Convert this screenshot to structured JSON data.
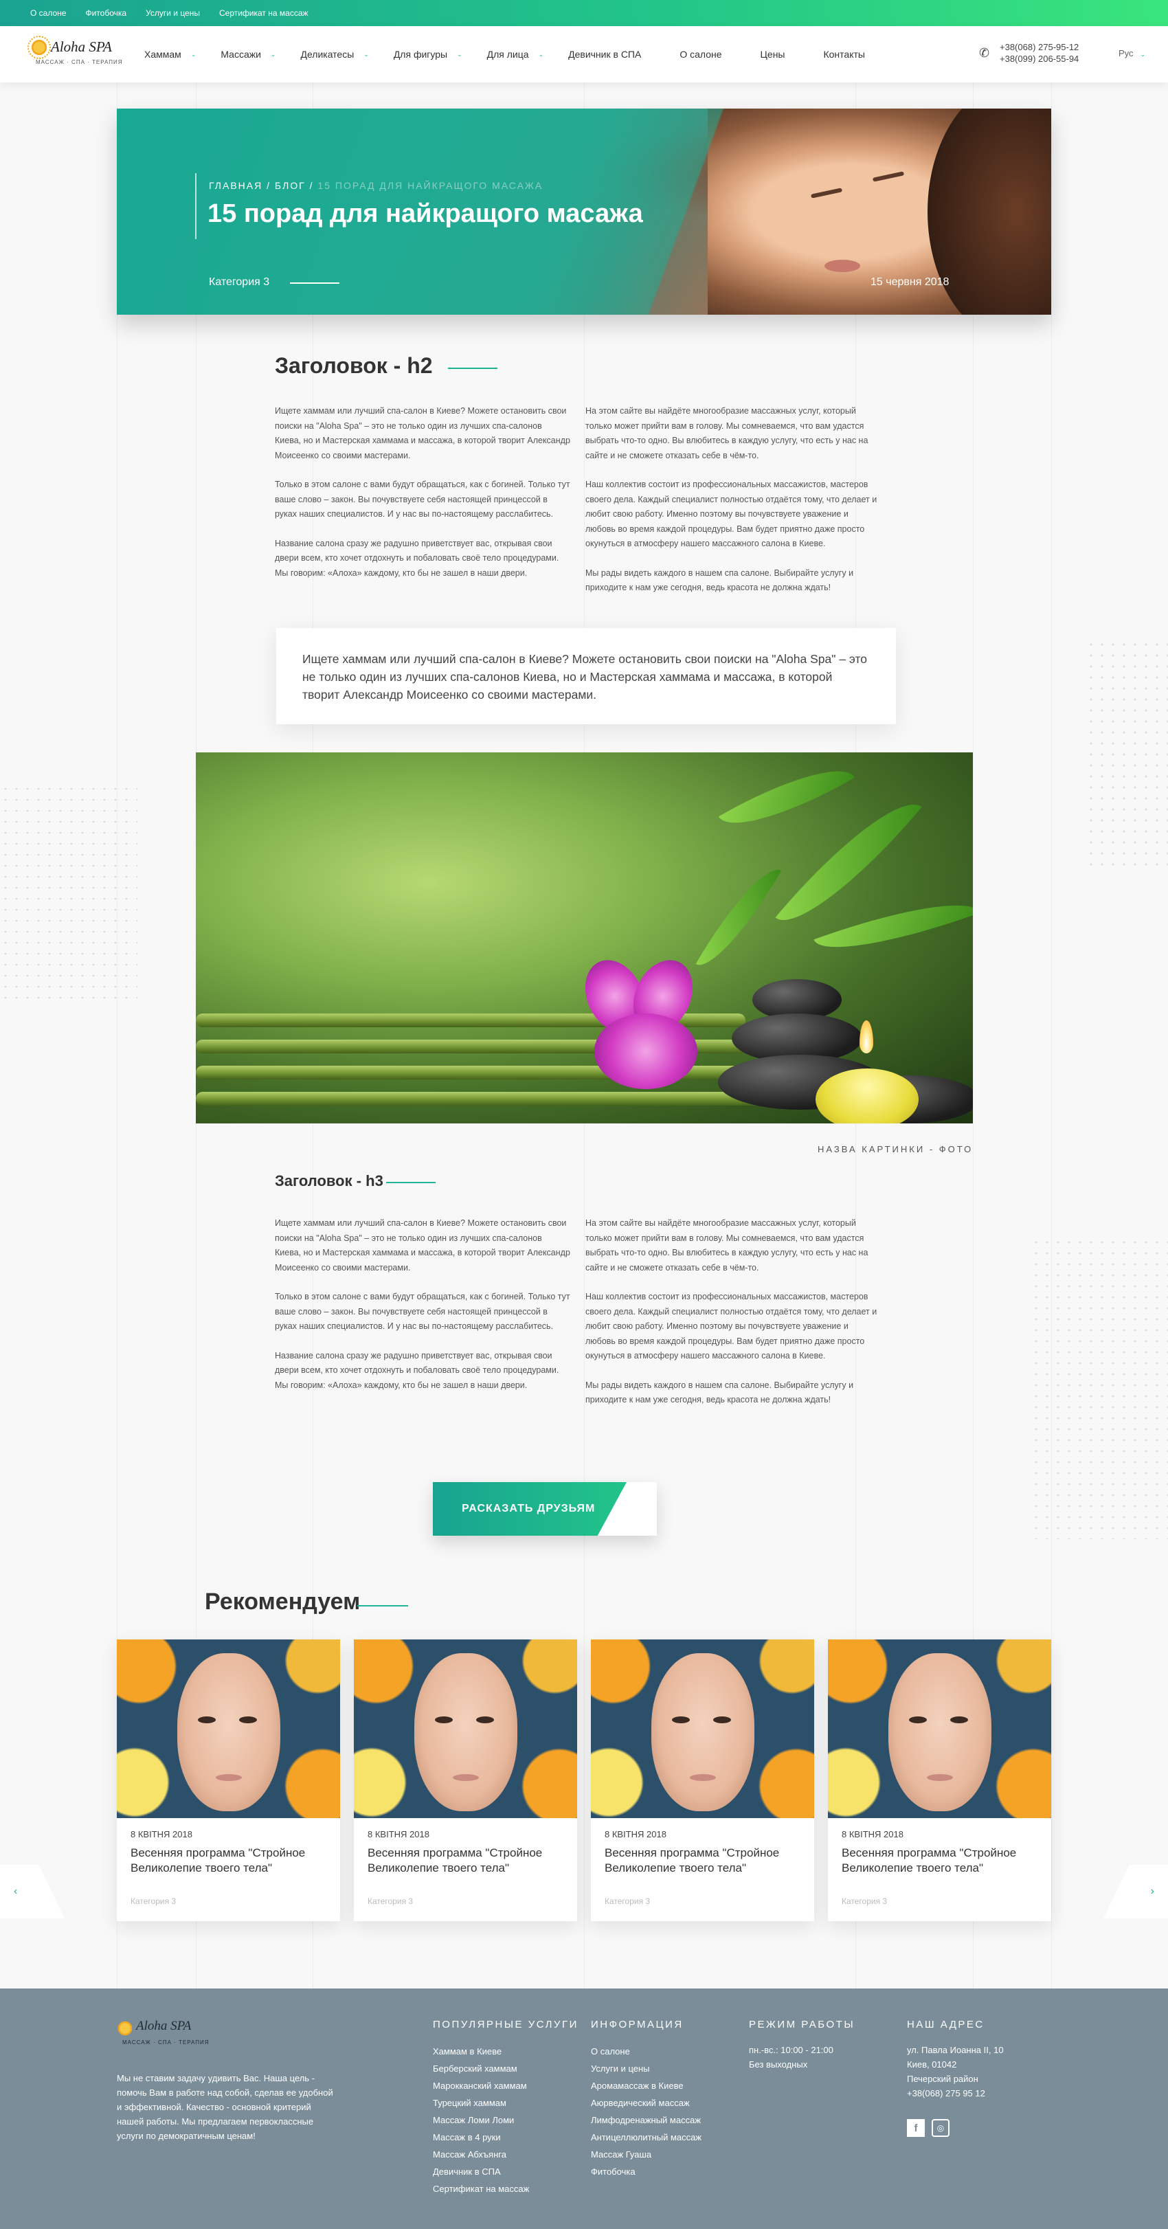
{
  "topbar": {
    "links": [
      "О салоне",
      "Фитобочка",
      "Услуги и цены",
      "Сертификат на массаж"
    ]
  },
  "header": {
    "logo_name": "Aloha SPA",
    "logo_tagline": "МАССАЖ · СПА · ТЕРАПИЯ",
    "nav": [
      {
        "label": "Хаммам",
        "dropdown": true
      },
      {
        "label": "Массажи",
        "dropdown": true
      },
      {
        "label": "Деликатесы",
        "dropdown": true
      },
      {
        "label": "Для фигуры",
        "dropdown": true
      },
      {
        "label": "Для лица",
        "dropdown": true
      },
      {
        "label": "Девичник в СПА",
        "dropdown": false
      },
      {
        "label": "О салоне",
        "dropdown": false
      },
      {
        "label": "Цены",
        "dropdown": false
      },
      {
        "label": "Контакты",
        "dropdown": false
      }
    ],
    "phones": [
      "+38(068) 275-95-12",
      "+38(099) 206-55-94"
    ],
    "language": "Рус"
  },
  "hero": {
    "breadcrumb_home": "ГЛАВНАЯ",
    "breadcrumb_blog": "БЛОГ",
    "breadcrumb_current": "15 ПОРАД ДЛЯ НАЙКРАЩОГО МАСАЖА",
    "separator": "/",
    "title": "15 порад для найкращого масажа",
    "category": "Категория 3",
    "date": "15 червня 2018"
  },
  "article": {
    "h2": "Заголовок - h2",
    "h3": "Заголовок - h3",
    "left_paragraphs": [
      "Ищете хаммам или лучший спа-салон в Киеве? Можете остановить свои поиски на \"Aloha Spa\" – это не только один из лучших спа-салонов Киева, но и Мастерская хаммама и массажа, в которой творит Александр Моисеенко со своими мастерами.",
      "Только в этом салоне с вами будут обращаться, как с богиней. Только тут ваше слово – закон. Вы почувствуете себя настоящей принцессой в руках наших специалистов. И у нас вы по-настоящему расслабитесь.",
      "Название салона сразу же радушно приветствует вас, открывая свои двери всем, кто хочет отдохнуть и побаловать своё тело процедурами. Мы говорим: «Алоха» каждому, кто бы не зашел в наши двери."
    ],
    "right_paragraphs": [
      "На этом сайте вы найдёте многообразие массажных услуг, который только может прийти вам в голову. Мы сомневаемся, что вам удастся выбрать что-то одно. Вы влюбитесь в каждую услугу, что есть у нас на сайте и не сможете отказать себе в чём-то.",
      "Наш коллектив состоит из профессиональных массажистов, мастеров своего дела. Каждый специалист полностью отдаётся тому, что делает и любит свою работу. Именно поэтому вы почувствуете уважение и любовь во время каждой процедуры. Вам будет приятно даже просто окунуться в атмосферу нашего массажного салона в Киеве.",
      "Мы рады видеть каждого в нашем спа салоне. Выбирайте услугу и приходите к нам уже сегодня, ведь красота не должна ждать!"
    ],
    "quote": "Ищете хаммам или лучший спа-салон в Киеве? Можете остановить свои поиски на \"Aloha Spa\" – это не только один из лучших спа-салонов Киева, но и Мастерская хаммама и массажа, в которой творит Александр Моисеенко со своими мастерами.",
    "image_caption": "НАЗВА КАРТИНКИ - ФОТО"
  },
  "share_button": "РАСКАЗАТЬ ДРУЗЬЯМ",
  "recommend": {
    "title": "Рекомендуем",
    "cards": [
      {
        "date": "8 квітня 2018",
        "title": "Весенняя программа \"Стройное Великолепие твоего тела\"",
        "category": "Категория 3"
      },
      {
        "date": "8 квітня 2018",
        "title": "Весенняя программа \"Стройное Великолепие твоего тела\"",
        "category": "Категория 3"
      },
      {
        "date": "8 квітня 2018",
        "title": "Весенняя программа \"Стройное Великолепие твоего тела\"",
        "category": "Категория 3"
      },
      {
        "date": "8 квітня 2018",
        "title": "Весенняя программа \"Стройное Великолепие твоего тела\"",
        "category": "Категория 3"
      }
    ],
    "prev_arrow": "‹",
    "next_arrow": "›"
  },
  "footer": {
    "logo_name": "Aloha SPA",
    "logo_tagline": "МАССАЖ · СПА · ТЕРАПИЯ",
    "about": "Мы не ставим задачу удивить Вас. Наша цель - помочь Вам в работе над собой, сделав ее удобной и эффективной. Качество - основной критерий нашей работы. Мы предлагаем первоклассные услуги по демократичным ценам!",
    "popular_title": "Популярные услуги",
    "popular": [
      "Хаммам в Киеве",
      "Берберский хаммам",
      "Марокканский хаммам",
      "Турецкий хаммам",
      "Массаж Ломи Ломи",
      "Массаж в 4 руки",
      "Массаж Абхъянга",
      "Девичник в СПА",
      "Сертификат на массаж"
    ],
    "info_title": "Информация",
    "info": [
      "О салоне",
      "Услуги и цены",
      "Аромамассаж в Киеве",
      "Аюрведический массаж",
      "Лимфодренажный массаж",
      "Антицеллюлитный массаж",
      "Массаж Гуаша",
      "Фитобочка"
    ],
    "hours_title": "Режим работы",
    "hours": [
      "пн.-вс.: 10:00 - 21:00",
      "Без выходных"
    ],
    "address_title": "Наш адрес",
    "address": [
      "ул. Павла Иоанна II, 10",
      "Киев, 01042",
      "Печерский район",
      "+38(068) 275 95 12"
    ],
    "social": {
      "facebook": "f",
      "instagram": "◎"
    }
  },
  "colors": {
    "accent": "#1fb596",
    "gradient_start": "#18a391",
    "gradient_end": "#39e57c",
    "footer_bg": "#7a8d99"
  }
}
